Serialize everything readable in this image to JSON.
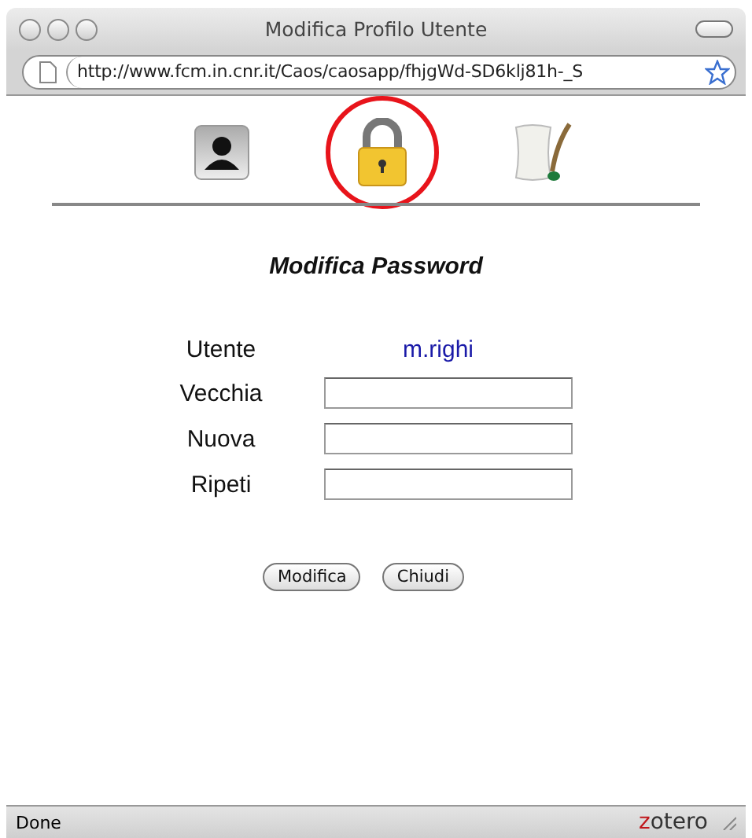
{
  "window": {
    "title": "Modifica Profilo Utente"
  },
  "address_bar": {
    "url": "http://www.fcm.in.cnr.it/Caos/caosapp/fhjgWd-SD6klj81h-_S"
  },
  "tabs": [
    {
      "kind": "user",
      "selected": false
    },
    {
      "kind": "lock",
      "selected": true
    },
    {
      "kind": "scroll",
      "selected": false
    }
  ],
  "form": {
    "title": "Modifica Password",
    "user_label": "Utente",
    "user_value": "m.righi",
    "fields": [
      {
        "label": "Vecchia"
      },
      {
        "label": "Nuova"
      },
      {
        "label": "Ripeti"
      }
    ],
    "buttons": [
      "Modifica",
      "Chiudi"
    ]
  },
  "status_bar": {
    "text": "Done",
    "brand": "zotero"
  }
}
